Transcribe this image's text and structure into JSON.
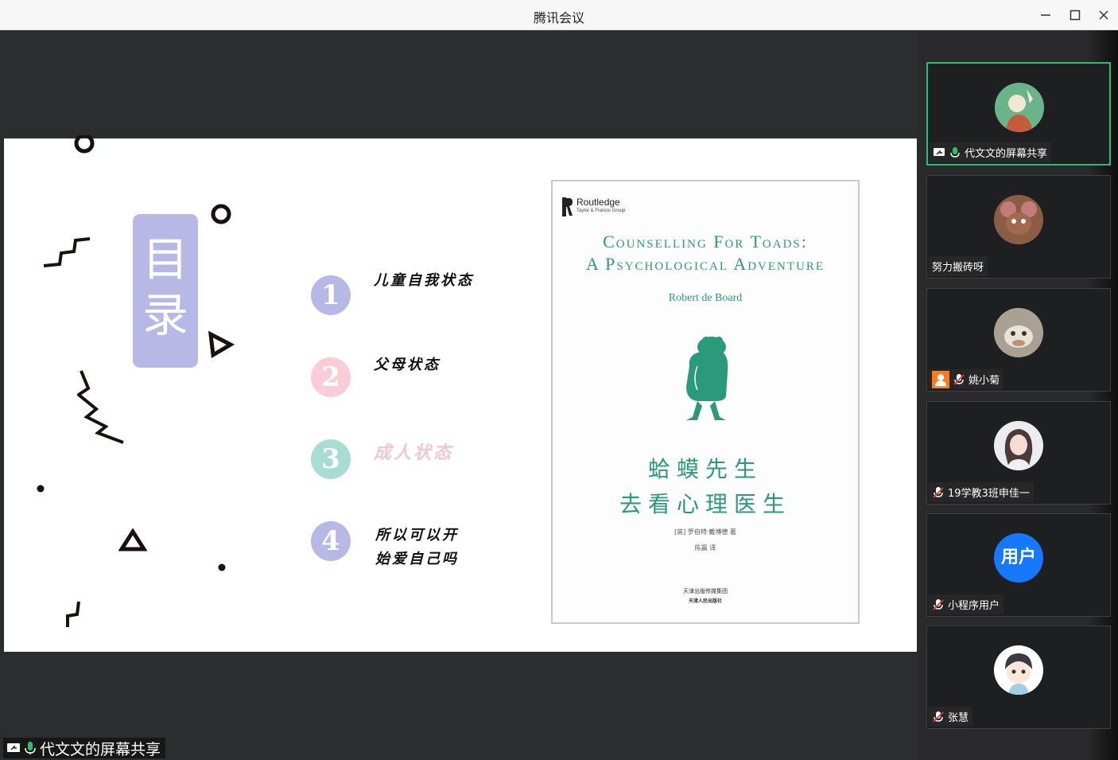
{
  "window": {
    "title": "腾讯会议"
  },
  "slide": {
    "toc_title_line1": "目",
    "toc_title_line2": "录",
    "items": [
      {
        "num": "1",
        "text": "儿童自我状态",
        "color": "#b8b8e6",
        "text_color": "#111111"
      },
      {
        "num": "2",
        "text": "父母状态",
        "color": "#f9ccd8",
        "text_color": "#111111"
      },
      {
        "num": "3",
        "text": "成人状态",
        "color": "#a8ddd4",
        "text_color": "#f4c6d3"
      },
      {
        "num": "4",
        "text_line1": "所以可以开",
        "text_line2": "始爱自己吗",
        "color": "#b8b8e6",
        "text_color": "#111111"
      }
    ]
  },
  "book": {
    "publisher": "Routledge",
    "publisher_sub": "Taylor & Francis Group",
    "title_en_line1": "Counselling For Toads:",
    "title_en_line2": "A Psychological Adventure",
    "author": "Robert de Board",
    "title_cn_line1": "蛤蟆先生",
    "title_cn_line2": "去看心理医生",
    "translator_line1": "[英] 罗伯特·戴博德 著",
    "translator_line2": "陈赢 译",
    "publisher_cn1": "天津出版传媒集团",
    "publisher_cn2": "天津人民出版社",
    "accent": "#2a9a7b"
  },
  "share_tag": {
    "label": "代文文的屏幕共享"
  },
  "participants": [
    {
      "name": "代文文的屏幕共享",
      "sharing": true,
      "mic": "on",
      "active": true
    },
    {
      "name": "努力搬砖呀",
      "sharing": false,
      "mic": "none",
      "active": false
    },
    {
      "name": "姚小菊",
      "sharing": false,
      "mic": "muted",
      "host_badge": true,
      "active": false
    },
    {
      "name": "19学教3班申佳一",
      "sharing": false,
      "mic": "muted",
      "active": false
    },
    {
      "name": "小程序用户",
      "avatar_text": "用户",
      "sharing": false,
      "mic": "muted",
      "active": false
    },
    {
      "name": "张慧",
      "sharing": false,
      "mic": "muted",
      "active": false
    }
  ]
}
